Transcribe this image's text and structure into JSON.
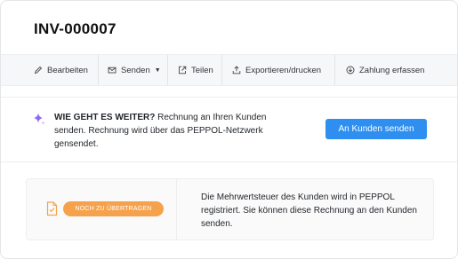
{
  "invoice": {
    "number": "INV-000007"
  },
  "toolbar": {
    "items": [
      {
        "label": "Bearbeiten",
        "icon": "pencil-icon"
      },
      {
        "label": "Senden",
        "icon": "mail-icon",
        "dropdown": true
      },
      {
        "label": "Teilen",
        "icon": "share-icon"
      },
      {
        "label": "Exportieren/drucken",
        "icon": "export-icon"
      },
      {
        "label": "Zahlung erfassen",
        "icon": "payment-icon"
      }
    ]
  },
  "next_step": {
    "icon": "sparkle-icon",
    "heading": "WIE GEHT ES WEITER?",
    "text": "Rechnung an Ihren Kunden senden. Rechnung wird über das PEPPOL-Netzwerk gensendet.",
    "button_label": "An Kunden senden",
    "button_color": "#2e8ff0"
  },
  "status": {
    "icon": "document-check-icon",
    "badge": "NOCH ZU ÜBERTRAGEN",
    "badge_color": "#f6a24c",
    "message": "Die Mehrwertsteuer des Kunden wird in PEPPOL registriert. Sie können diese Rechnung an den Kunden senden."
  }
}
